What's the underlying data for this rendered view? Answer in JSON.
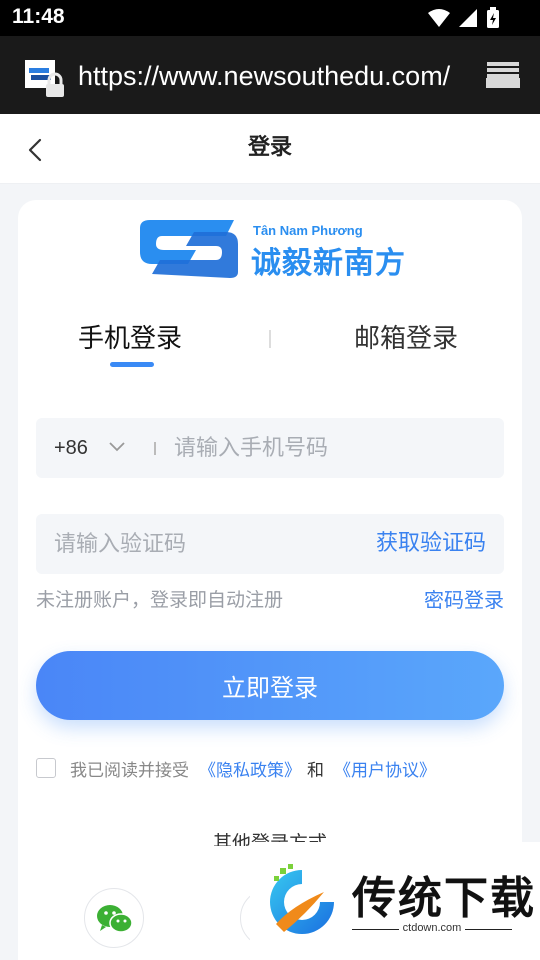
{
  "status_bar": {
    "time": "11:48"
  },
  "browser": {
    "url": "https://www.newsouthedu.com/"
  },
  "header": {
    "title": "登录"
  },
  "logo": {
    "subtitle": "Tân Nam Phương",
    "name": "诚毅新南方"
  },
  "tabs": [
    {
      "label": "手机登录",
      "active": true
    },
    {
      "label": "邮箱登录",
      "active": false
    }
  ],
  "phone_field": {
    "country_code": "+86",
    "placeholder": "请输入手机号码",
    "value": ""
  },
  "code_field": {
    "placeholder": "请输入验证码",
    "value": "",
    "action_label": "获取验证码"
  },
  "hint": "未注册账户，登录即自动注册",
  "password_login_label": "密码登录",
  "login_button_label": "立即登录",
  "agreement": {
    "checked": false,
    "text": "我已阅读并接受",
    "privacy_link": "《隐私政策》",
    "and": "和",
    "terms_link": "《用户协议》"
  },
  "other_login": {
    "title": "其他登录方式",
    "methods": [
      "wechat-icon",
      "login-method-icon"
    ]
  },
  "watermark": {
    "name": "传统下载",
    "url": "ctdown.com"
  },
  "colors": {
    "accent": "#3a82f0",
    "button_start": "#4a86f7",
    "button_end": "#5aa7fb",
    "logo": "#2a8ef0"
  }
}
